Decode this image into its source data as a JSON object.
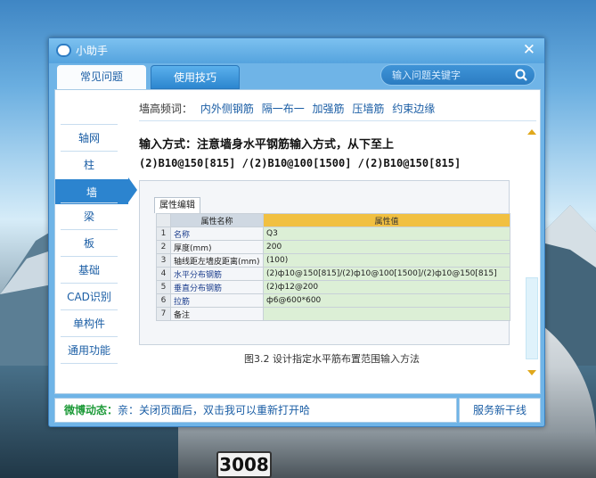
{
  "window": {
    "title": "小助手",
    "close_glyph": "✕"
  },
  "tabs": [
    {
      "label": "常见问题",
      "active": true
    },
    {
      "label": "使用技巧",
      "active": false
    }
  ],
  "search": {
    "placeholder": "输入问题关键字"
  },
  "sidebar": {
    "items": [
      {
        "label": "轴网"
      },
      {
        "label": "柱"
      },
      {
        "label": "墙",
        "active": true
      },
      {
        "label": "梁"
      },
      {
        "label": "板"
      },
      {
        "label": "基础"
      },
      {
        "label": "CAD识别"
      },
      {
        "label": "单构件"
      },
      {
        "label": "通用功能"
      }
    ]
  },
  "content": {
    "freq_label": "墙高频词：",
    "freq_links": [
      "内外侧钢筋",
      "隔一布一",
      "加强筋",
      "压墙筋",
      "约束边缘"
    ],
    "heading": "输入方式：注意墙身水平钢筋输入方式，从下至上",
    "formula": "(2)B10@150[815] /(2)B10@100[1500] /(2)B10@150[815]",
    "figure": {
      "tab_label": "属性编辑",
      "header": {
        "name": "属性名称",
        "value": "属性值"
      },
      "rows": [
        {
          "num": "1",
          "name": "名称",
          "value": "Q3",
          "highlight": true
        },
        {
          "num": "2",
          "name": "厚度(mm)",
          "value": "200",
          "highlight": false
        },
        {
          "num": "3",
          "name": "轴线距左墙皮距离(mm)",
          "value": "(100)",
          "highlight": false
        },
        {
          "num": "4",
          "name": "水平分布钢筋",
          "value": "(2)ф10@150[815]/(2)ф10@100[1500]/(2)ф10@150[815]",
          "highlight": true
        },
        {
          "num": "5",
          "name": "垂直分布钢筋",
          "value": "(2)ф12@200",
          "highlight": true
        },
        {
          "num": "6",
          "name": "拉筋",
          "value": "ф6@600*600",
          "highlight": true
        },
        {
          "num": "7",
          "name": "备注",
          "value": "",
          "highlight": false
        }
      ],
      "caption": "图3.2 设计指定水平筋布置范围输入方法"
    }
  },
  "footer": {
    "weibo_label": "微博动态：",
    "message": "亲：关闭页面后，双击我可以重新打开哈",
    "new_line_button": "服务新干线"
  },
  "background": {
    "plate_text": "3008"
  },
  "colors": {
    "accent": "#2c84cf",
    "link": "#1b5ea5",
    "weibo": "#1f9b3a",
    "header_value": "#f1c041",
    "value_cell": "#dcefd6"
  }
}
